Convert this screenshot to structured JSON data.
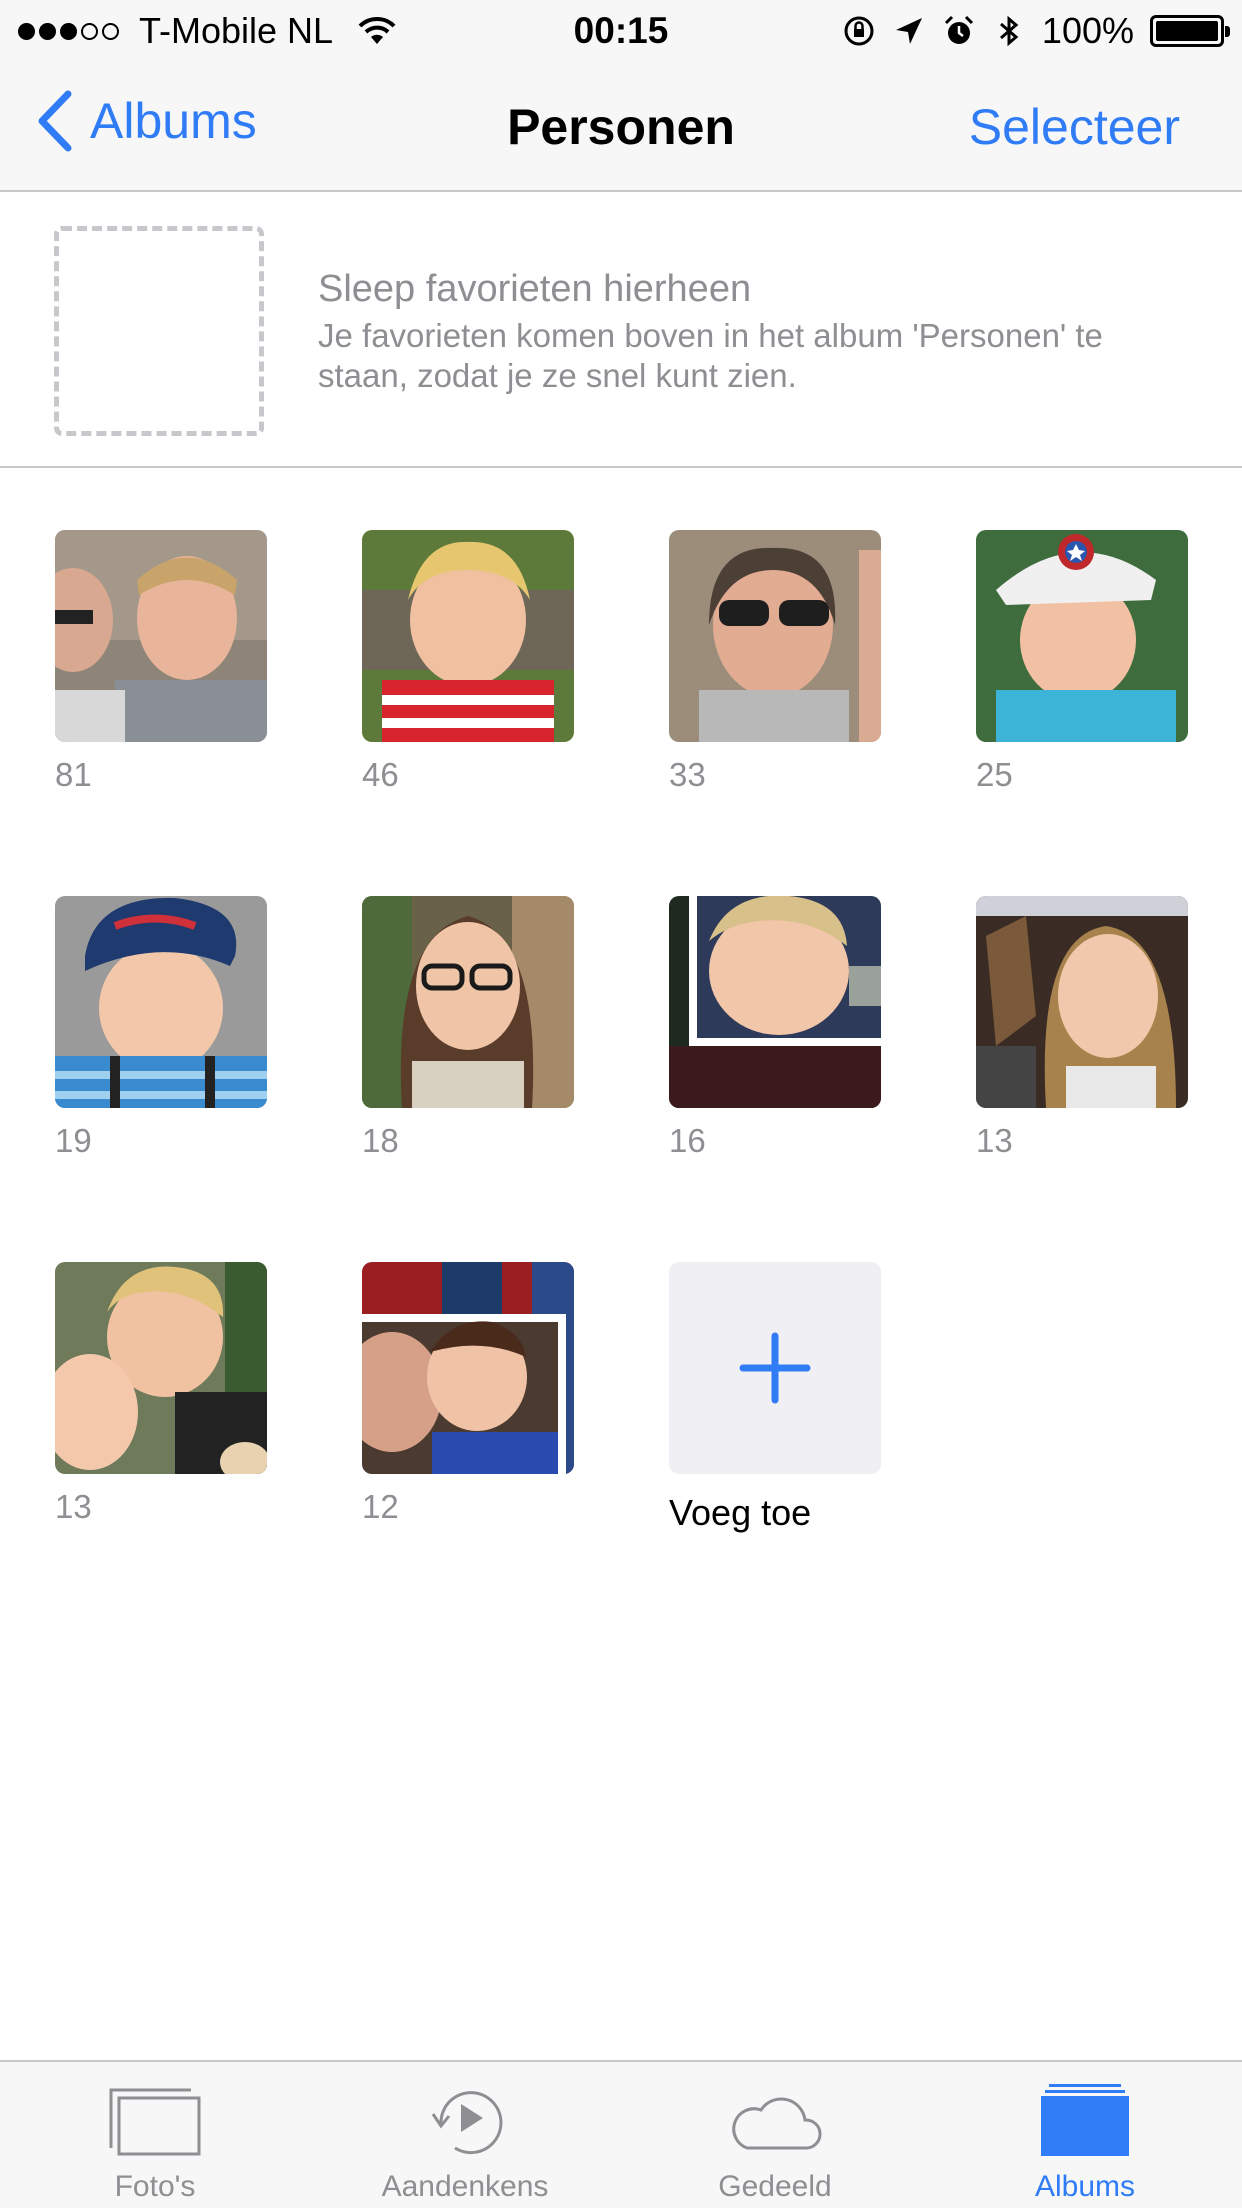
{
  "status_bar": {
    "carrier": "T-Mobile NL",
    "time": "00:15",
    "battery": "100%"
  },
  "nav": {
    "back_label": "Albums",
    "title": "Personen",
    "select_label": "Selecteer"
  },
  "favorites": {
    "title": "Sleep favorieten hierheen",
    "description": "Je favorieten komen boven in het album 'Personen' te staan, zodat je ze snel kunt zien."
  },
  "people": [
    {
      "count": "81"
    },
    {
      "count": "46"
    },
    {
      "count": "33"
    },
    {
      "count": "25"
    },
    {
      "count": "19"
    },
    {
      "count": "18"
    },
    {
      "count": "16"
    },
    {
      "count": "13"
    },
    {
      "count": "13"
    },
    {
      "count": "12"
    }
  ],
  "add": {
    "label": "Voeg toe"
  },
  "tabs": [
    {
      "label": "Foto's",
      "icon": "photos-icon"
    },
    {
      "label": "Aandenkens",
      "icon": "memories-icon"
    },
    {
      "label": "Gedeeld",
      "icon": "cloud-icon"
    },
    {
      "label": "Albums",
      "icon": "albums-icon",
      "active": true
    }
  ],
  "colors": {
    "accent": "#2f7cf6"
  }
}
